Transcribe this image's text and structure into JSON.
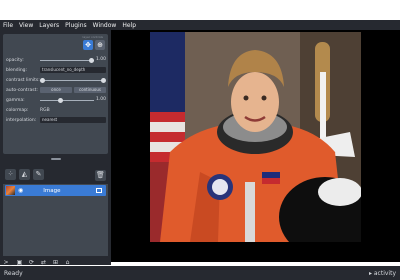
{
  "menu": [
    "File",
    "View",
    "Layers",
    "Plugins",
    "Window",
    "Help"
  ],
  "controls": {
    "header_hint": "layer controls",
    "opacity": {
      "label": "opacity:",
      "value": "1.00",
      "level": 1.0
    },
    "blending": {
      "label": "blending:",
      "value": "translucent_no_depth"
    },
    "contrast": {
      "label": "contrast limits:",
      "low": 0.0,
      "high": 1.0
    },
    "auto_contrast": {
      "label": "auto-contrast:",
      "once": "once",
      "continuous": "continuous"
    },
    "gamma": {
      "label": "gamma:",
      "value": "1.00",
      "level": 0.5
    },
    "colormap": {
      "label": "colormap:",
      "value": "RGB"
    },
    "interpolation": {
      "label": "interpolation:",
      "value": "nearest"
    }
  },
  "layer_tools": {
    "hint": "layer list"
  },
  "layers": [
    {
      "name": "Image"
    }
  ],
  "status": {
    "left": "Ready",
    "right": "▸ activity"
  },
  "icons": [
    "pan-zoom-icon",
    "transform-icon",
    "points-icon",
    "shapes-icon",
    "labels-icon",
    "trash-icon",
    "console-icon",
    "ndisplay-icon",
    "roll-icon",
    "transpose-icon",
    "grid-icon",
    "home-icon",
    "eye-icon"
  ],
  "accent": "#3a7bd5"
}
